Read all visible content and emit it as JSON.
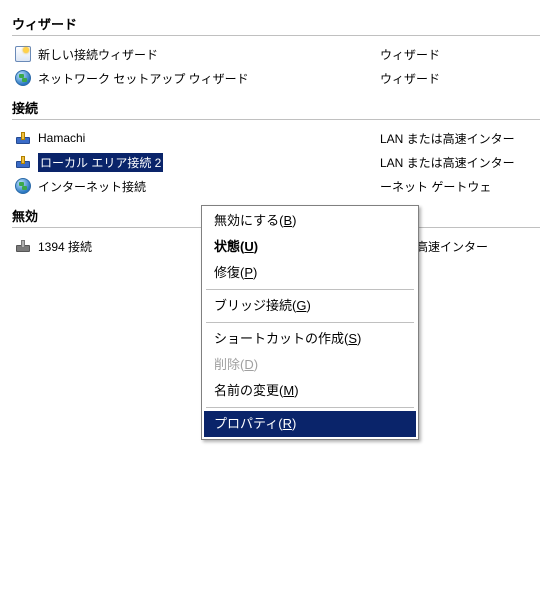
{
  "groups": {
    "wizard": {
      "title": "ウィザード",
      "items": [
        {
          "label": "新しい接続ウィザード",
          "type": "ウィザード",
          "icon": "wizard"
        },
        {
          "label": "ネットワーク セットアップ ウィザード",
          "type": "ウィザード",
          "icon": "globe"
        }
      ]
    },
    "connection": {
      "title": "接続",
      "items": [
        {
          "label": "Hamachi",
          "type": "LAN または高速インター",
          "icon": "lan"
        },
        {
          "label": "ローカル エリア接続 2",
          "type": "LAN または高速インター",
          "icon": "lan",
          "selected": true
        },
        {
          "label": "インターネット接続",
          "type": "ーネット ゲートウェ",
          "icon": "globe"
        }
      ]
    },
    "disabled": {
      "title": "無効",
      "items": [
        {
          "label": "1394 接続",
          "type": "または高速インター",
          "icon": "lan-x"
        }
      ]
    }
  },
  "context_menu": {
    "items": [
      {
        "text": "無効にする",
        "accel": "B"
      },
      {
        "text": "状態",
        "accel": "U",
        "bold": true
      },
      {
        "text": "修復",
        "accel": "P"
      },
      {
        "sep": true
      },
      {
        "text": "ブリッジ接続",
        "accel": "G"
      },
      {
        "sep": true
      },
      {
        "text": "ショートカットの作成",
        "accel": "S"
      },
      {
        "text": "削除",
        "accel": "D",
        "disabled": true
      },
      {
        "text": "名前の変更",
        "accel": "M"
      },
      {
        "sep": true
      },
      {
        "text": "プロパティ",
        "accel": "R",
        "highlight": true
      }
    ]
  }
}
